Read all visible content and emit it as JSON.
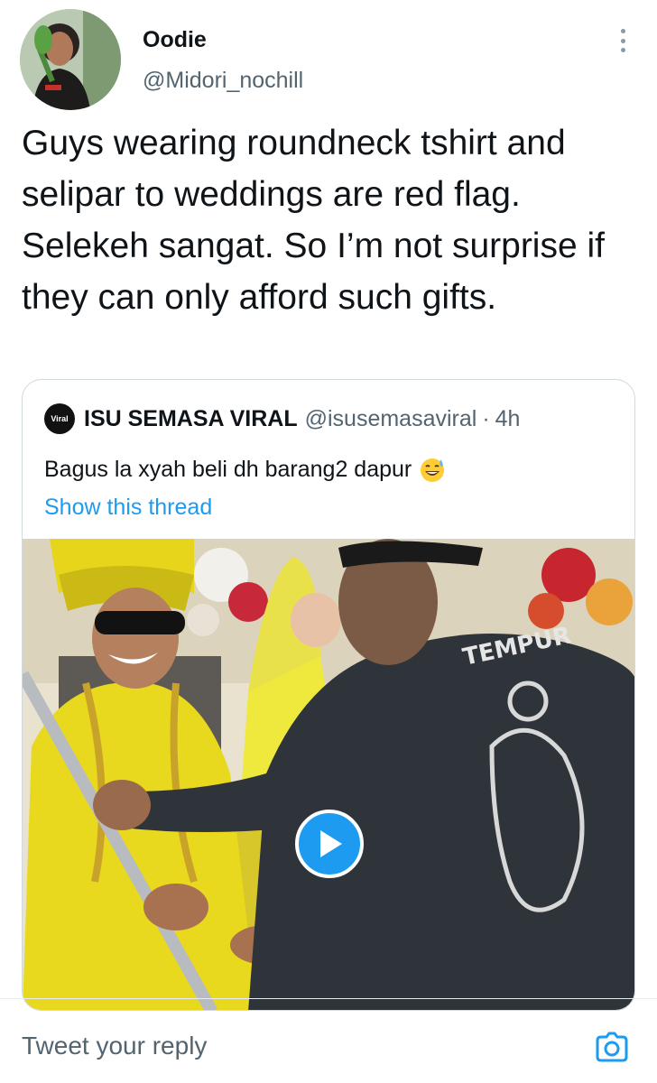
{
  "author": {
    "name": "Oodie",
    "handle": "@Midori_nochill"
  },
  "tweet": {
    "text": "Guys wearing roundneck tshirt and selipar to weddings are red flag. Selekeh sangat. So I’m not surprise if they can only afford such gifts."
  },
  "quoted": {
    "avatar_text": "Viral",
    "name": "ISU SEMASA VIRAL",
    "handle": "@isusemasaviral",
    "separator": "·",
    "time": "4h",
    "text": "Bagus la xyah beli dh barang2 dapur",
    "emoji": "grinning-sweat-emoji",
    "show_thread": "Show this thread",
    "shirt_print": "TEMPUR"
  },
  "reply": {
    "placeholder": "Tweet your reply"
  },
  "colors": {
    "accent": "#1d9bf0",
    "text_primary": "#0f1419",
    "text_secondary": "#536471",
    "border": "#cfd9de",
    "groom_outfit": "#e8d81e",
    "tshirt": "#2f343a"
  }
}
